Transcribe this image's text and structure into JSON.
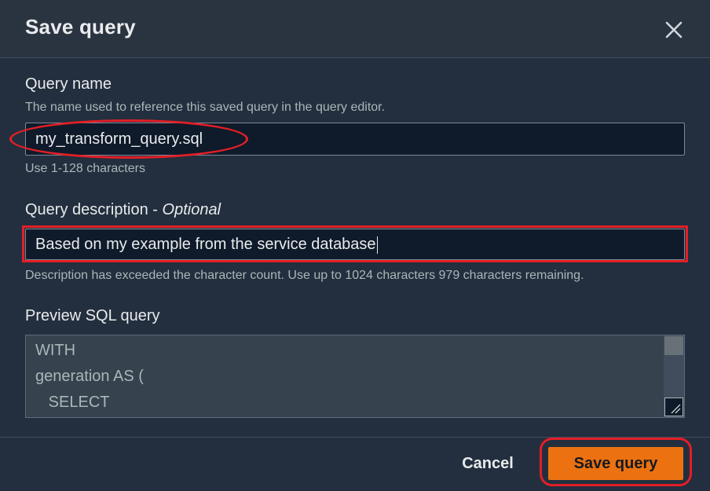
{
  "dialog": {
    "title": "Save query",
    "close_icon": "close-icon"
  },
  "query_name": {
    "label": "Query name",
    "description": "The name used to reference this saved query in the query editor.",
    "value": "my_transform_query.sql",
    "constraint": "Use 1-128 characters"
  },
  "query_description": {
    "label": "Query description",
    "label_separator": " - ",
    "optional": "Optional",
    "value": "Based on my example from the service database",
    "hint": "Description has exceeded the character count. Use up to 1024 characters 979 characters remaining."
  },
  "preview": {
    "label": "Preview SQL query",
    "lines": [
      "WITH",
      "generation AS (",
      "   SELECT"
    ]
  },
  "footer": {
    "cancel_label": "Cancel",
    "save_label": "Save query"
  },
  "colors": {
    "background": "#232f3e",
    "primary_button": "#ec7211",
    "annotation": "#e41e26"
  }
}
